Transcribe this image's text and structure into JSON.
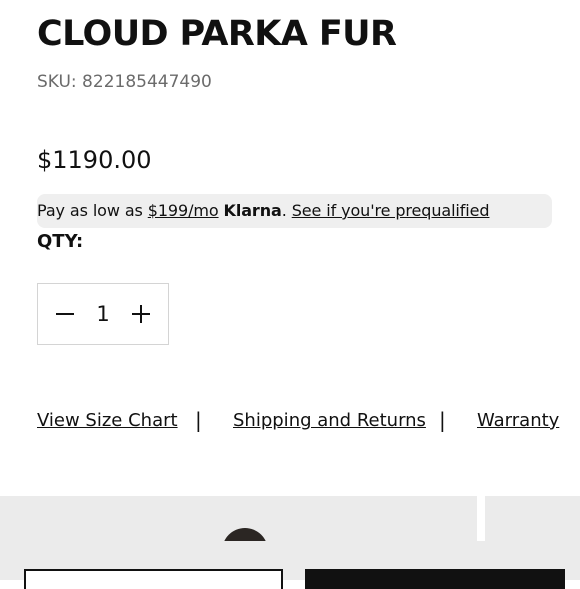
{
  "product": {
    "title": "CLOUD PARKA FUR",
    "sku": "SKU: 822185447490",
    "price": "$1190.00"
  },
  "klarna": {
    "prefix": "Pay as low as ",
    "amount": "$199/mo",
    "space": " ",
    "brand": "Klarna",
    "period": ". ",
    "link": "See if you're prequalified"
  },
  "quantity": {
    "label": "QTY:",
    "value": "1"
  },
  "links": {
    "size_chart": "View Size Chart",
    "separator": "|",
    "shipping": "Shipping and Returns",
    "warranty": "Warranty"
  }
}
